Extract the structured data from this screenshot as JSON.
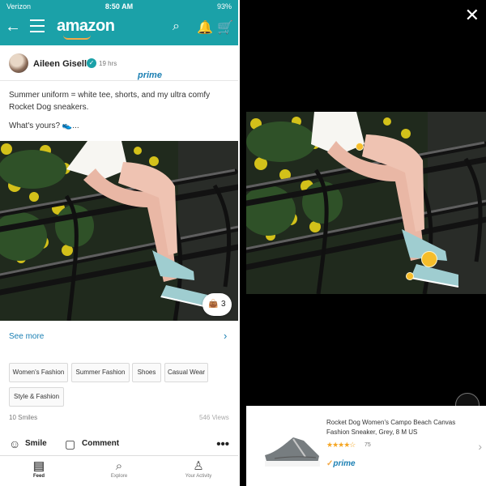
{
  "status": {
    "carrier": "Verizon",
    "time": "8:50 AM",
    "battery": "93%"
  },
  "header": {
    "logo_word": "amazon",
    "logo_sub": "prime"
  },
  "post": {
    "author": "Aileen Giselle",
    "age": "19 hrs",
    "text": "Summer uniform = white tee, shorts, and my ultra comfy Rocket Dog sneakers.",
    "question": "What's yours? 👟...",
    "bag_count": "3",
    "see_more": "See more",
    "tags": [
      "Women's Fashion",
      "Summer Fashion",
      "Shoes",
      "Casual Wear",
      "Style & Fashion"
    ],
    "smiles": "10 Smiles",
    "views": "546 Views",
    "actions": {
      "smile": "Smile",
      "comment": "Comment"
    }
  },
  "tabs": [
    {
      "label": "Feed",
      "icon": "feed-icon",
      "active": true
    },
    {
      "label": "Explore",
      "icon": "search-icon",
      "active": false
    },
    {
      "label": "Your Activity",
      "icon": "person-icon",
      "active": false
    }
  ],
  "product": {
    "title": "Rocket Dog Women's Campo Beach Canvas Fashion Sneaker, Grey, 8 M US",
    "rating": 4,
    "rating_count": "75",
    "prime": "prime"
  },
  "colors": {
    "teal": "#1ba1a8",
    "link": "#1a7fb3",
    "hotspot": "#f6bd2a"
  }
}
